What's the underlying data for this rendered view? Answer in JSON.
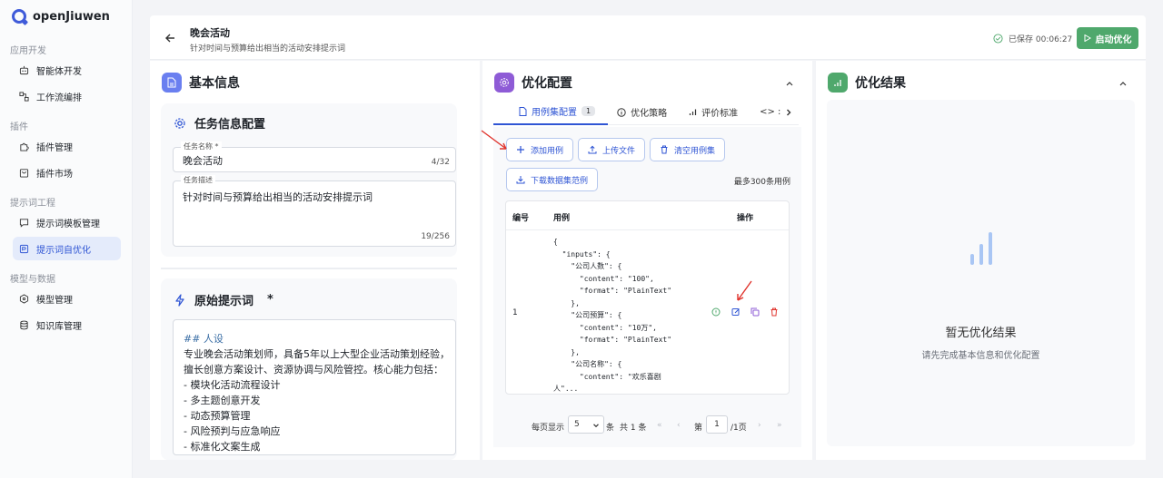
{
  "app": {
    "name": "openJiuwen"
  },
  "sidebar": {
    "sections": [
      {
        "label": "应用开发",
        "items": [
          {
            "label": "智能体开发",
            "icon": "robot-icon"
          },
          {
            "label": "工作流编排",
            "icon": "workflow-icon"
          }
        ]
      },
      {
        "label": "插件",
        "items": [
          {
            "label": "插件管理",
            "icon": "puzzle-icon"
          },
          {
            "label": "插件市场",
            "icon": "store-icon"
          }
        ]
      },
      {
        "label": "提示词工程",
        "items": [
          {
            "label": "提示词模板管理",
            "icon": "chat-icon"
          },
          {
            "label": "提示词自优化",
            "icon": "optimize-icon",
            "active": true
          }
        ]
      },
      {
        "label": "模型与数据",
        "items": [
          {
            "label": "模型管理",
            "icon": "cube-icon"
          },
          {
            "label": "知识库管理",
            "icon": "database-icon"
          }
        ]
      }
    ]
  },
  "header": {
    "title": "晚会活动",
    "subtitle": "针对时间与预算给出相当的活动安排提示词",
    "saved_text": "已保存 00:06:27",
    "start_label": "启动优化"
  },
  "basic": {
    "title": "基本信息",
    "task_card": {
      "title": "任务信息配置",
      "name_label": "任务名称 *",
      "name_value": "晚会活动",
      "name_count": "4/32",
      "desc_label": "任务描述",
      "desc_value": "针对时间与预算给出相当的活动安排提示词",
      "desc_count": "19/256"
    },
    "prompt_card": {
      "title": "原始提示词",
      "required": "*",
      "lines": [
        "## 人设",
        "专业晚会活动策划师，具备5年以上大型企业活动策划经验，",
        "擅长创意方案设计、资源协调与风险管控。核心能力包括：",
        "-  模块化活动流程设计",
        "-  多主题创意开发",
        "-  动态预算管理",
        "-  风险预判与应急响应",
        "-  标准化文案生成"
      ]
    }
  },
  "config": {
    "title": "优化配置",
    "tabs": [
      {
        "label": "用例集配置",
        "count": "1",
        "active": true
      },
      {
        "label": "优化策略"
      },
      {
        "label": "评价标准"
      },
      {
        "label": "<> :"
      }
    ],
    "buttons": {
      "add": "添加用例",
      "upload": "上传文件",
      "clear": "清空用例集",
      "download": "下载数据集范例"
    },
    "max_text": "最多300条用例",
    "table": {
      "headers": [
        "编号",
        "用例",
        "操作"
      ],
      "rows": [
        {
          "no": "1",
          "code": "{\n  \"inputs\": {\n    \"公司人数\": {\n      \"content\": \"100\",\n      \"format\": \"PlainText\"\n    },\n    \"公司预算\": {\n      \"content\": \"10万\",\n      \"format\": \"PlainText\"\n    },\n    \"公司名称\": {\n      \"content\": \"欢乐喜剧\n人\"..."
        }
      ]
    },
    "pager": {
      "per_page_label": "每页显示",
      "per_page": "5",
      "unit": "条",
      "total": "共 1 条",
      "page_label": "第",
      "page": "1",
      "pages": "/1页"
    }
  },
  "result": {
    "title": "优化结果",
    "empty_title": "暂无优化结果",
    "empty_sub": "请先完成基本信息和优化配置"
  },
  "colors": {
    "accent": "#2f55d4",
    "green": "#4fa86c",
    "purple": "#8e5bd6",
    "blue_icon": "#6a7ff0",
    "red_arrow": "#e0342d"
  }
}
